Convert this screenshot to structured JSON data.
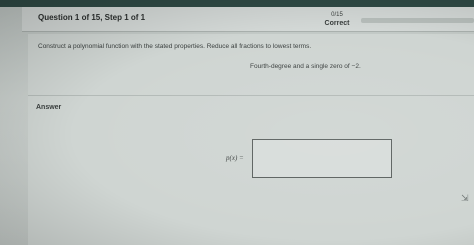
{
  "header": {
    "question_title": "Question 1 of 15, Step 1 of 1",
    "score": "0/15",
    "status": "Correct"
  },
  "question": {
    "instruction": "Construct a polynomial function with the stated properties. Reduce all fractions to lowest terms.",
    "condition": "Fourth-degree and a single zero of −2."
  },
  "answer": {
    "section_label": "Answer",
    "function_label": "p(x) =",
    "input_value": ""
  },
  "cursor": {
    "icon": "mouse-pointer-icon"
  }
}
